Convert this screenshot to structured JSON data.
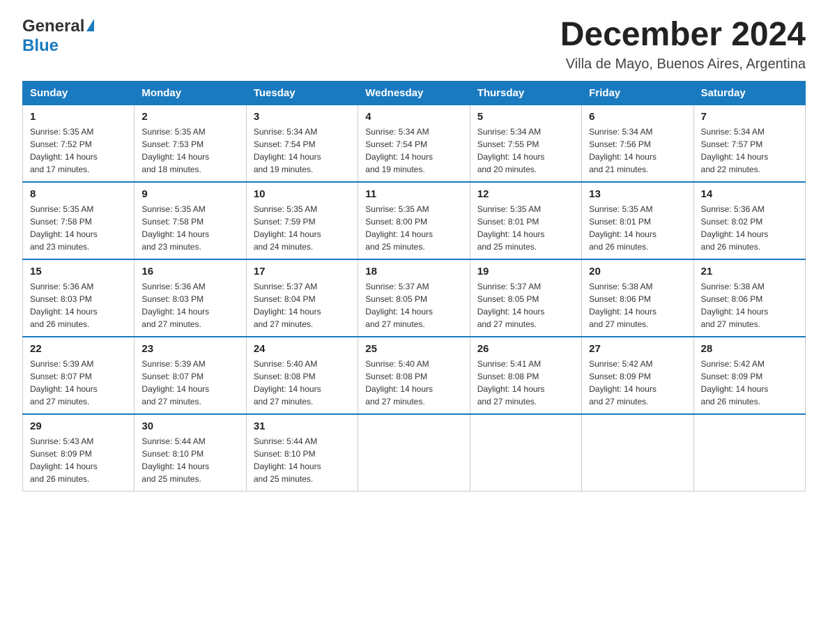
{
  "header": {
    "logo_general": "General",
    "logo_blue": "Blue",
    "title": "December 2024",
    "subtitle": "Villa de Mayo, Buenos Aires, Argentina"
  },
  "calendar": {
    "days_of_week": [
      "Sunday",
      "Monday",
      "Tuesday",
      "Wednesday",
      "Thursday",
      "Friday",
      "Saturday"
    ],
    "weeks": [
      [
        {
          "day": "1",
          "sunrise": "5:35 AM",
          "sunset": "7:52 PM",
          "daylight": "14 hours and 17 minutes."
        },
        {
          "day": "2",
          "sunrise": "5:35 AM",
          "sunset": "7:53 PM",
          "daylight": "14 hours and 18 minutes."
        },
        {
          "day": "3",
          "sunrise": "5:34 AM",
          "sunset": "7:54 PM",
          "daylight": "14 hours and 19 minutes."
        },
        {
          "day": "4",
          "sunrise": "5:34 AM",
          "sunset": "7:54 PM",
          "daylight": "14 hours and 19 minutes."
        },
        {
          "day": "5",
          "sunrise": "5:34 AM",
          "sunset": "7:55 PM",
          "daylight": "14 hours and 20 minutes."
        },
        {
          "day": "6",
          "sunrise": "5:34 AM",
          "sunset": "7:56 PM",
          "daylight": "14 hours and 21 minutes."
        },
        {
          "day": "7",
          "sunrise": "5:34 AM",
          "sunset": "7:57 PM",
          "daylight": "14 hours and 22 minutes."
        }
      ],
      [
        {
          "day": "8",
          "sunrise": "5:35 AM",
          "sunset": "7:58 PM",
          "daylight": "14 hours and 23 minutes."
        },
        {
          "day": "9",
          "sunrise": "5:35 AM",
          "sunset": "7:58 PM",
          "daylight": "14 hours and 23 minutes."
        },
        {
          "day": "10",
          "sunrise": "5:35 AM",
          "sunset": "7:59 PM",
          "daylight": "14 hours and 24 minutes."
        },
        {
          "day": "11",
          "sunrise": "5:35 AM",
          "sunset": "8:00 PM",
          "daylight": "14 hours and 25 minutes."
        },
        {
          "day": "12",
          "sunrise": "5:35 AM",
          "sunset": "8:01 PM",
          "daylight": "14 hours and 25 minutes."
        },
        {
          "day": "13",
          "sunrise": "5:35 AM",
          "sunset": "8:01 PM",
          "daylight": "14 hours and 26 minutes."
        },
        {
          "day": "14",
          "sunrise": "5:36 AM",
          "sunset": "8:02 PM",
          "daylight": "14 hours and 26 minutes."
        }
      ],
      [
        {
          "day": "15",
          "sunrise": "5:36 AM",
          "sunset": "8:03 PM",
          "daylight": "14 hours and 26 minutes."
        },
        {
          "day": "16",
          "sunrise": "5:36 AM",
          "sunset": "8:03 PM",
          "daylight": "14 hours and 27 minutes."
        },
        {
          "day": "17",
          "sunrise": "5:37 AM",
          "sunset": "8:04 PM",
          "daylight": "14 hours and 27 minutes."
        },
        {
          "day": "18",
          "sunrise": "5:37 AM",
          "sunset": "8:05 PM",
          "daylight": "14 hours and 27 minutes."
        },
        {
          "day": "19",
          "sunrise": "5:37 AM",
          "sunset": "8:05 PM",
          "daylight": "14 hours and 27 minutes."
        },
        {
          "day": "20",
          "sunrise": "5:38 AM",
          "sunset": "8:06 PM",
          "daylight": "14 hours and 27 minutes."
        },
        {
          "day": "21",
          "sunrise": "5:38 AM",
          "sunset": "8:06 PM",
          "daylight": "14 hours and 27 minutes."
        }
      ],
      [
        {
          "day": "22",
          "sunrise": "5:39 AM",
          "sunset": "8:07 PM",
          "daylight": "14 hours and 27 minutes."
        },
        {
          "day": "23",
          "sunrise": "5:39 AM",
          "sunset": "8:07 PM",
          "daylight": "14 hours and 27 minutes."
        },
        {
          "day": "24",
          "sunrise": "5:40 AM",
          "sunset": "8:08 PM",
          "daylight": "14 hours and 27 minutes."
        },
        {
          "day": "25",
          "sunrise": "5:40 AM",
          "sunset": "8:08 PM",
          "daylight": "14 hours and 27 minutes."
        },
        {
          "day": "26",
          "sunrise": "5:41 AM",
          "sunset": "8:08 PM",
          "daylight": "14 hours and 27 minutes."
        },
        {
          "day": "27",
          "sunrise": "5:42 AM",
          "sunset": "8:09 PM",
          "daylight": "14 hours and 27 minutes."
        },
        {
          "day": "28",
          "sunrise": "5:42 AM",
          "sunset": "8:09 PM",
          "daylight": "14 hours and 26 minutes."
        }
      ],
      [
        {
          "day": "29",
          "sunrise": "5:43 AM",
          "sunset": "8:09 PM",
          "daylight": "14 hours and 26 minutes."
        },
        {
          "day": "30",
          "sunrise": "5:44 AM",
          "sunset": "8:10 PM",
          "daylight": "14 hours and 25 minutes."
        },
        {
          "day": "31",
          "sunrise": "5:44 AM",
          "sunset": "8:10 PM",
          "daylight": "14 hours and 25 minutes."
        },
        null,
        null,
        null,
        null
      ]
    ],
    "labels": {
      "sunrise": "Sunrise:",
      "sunset": "Sunset:",
      "daylight": "Daylight:"
    }
  }
}
